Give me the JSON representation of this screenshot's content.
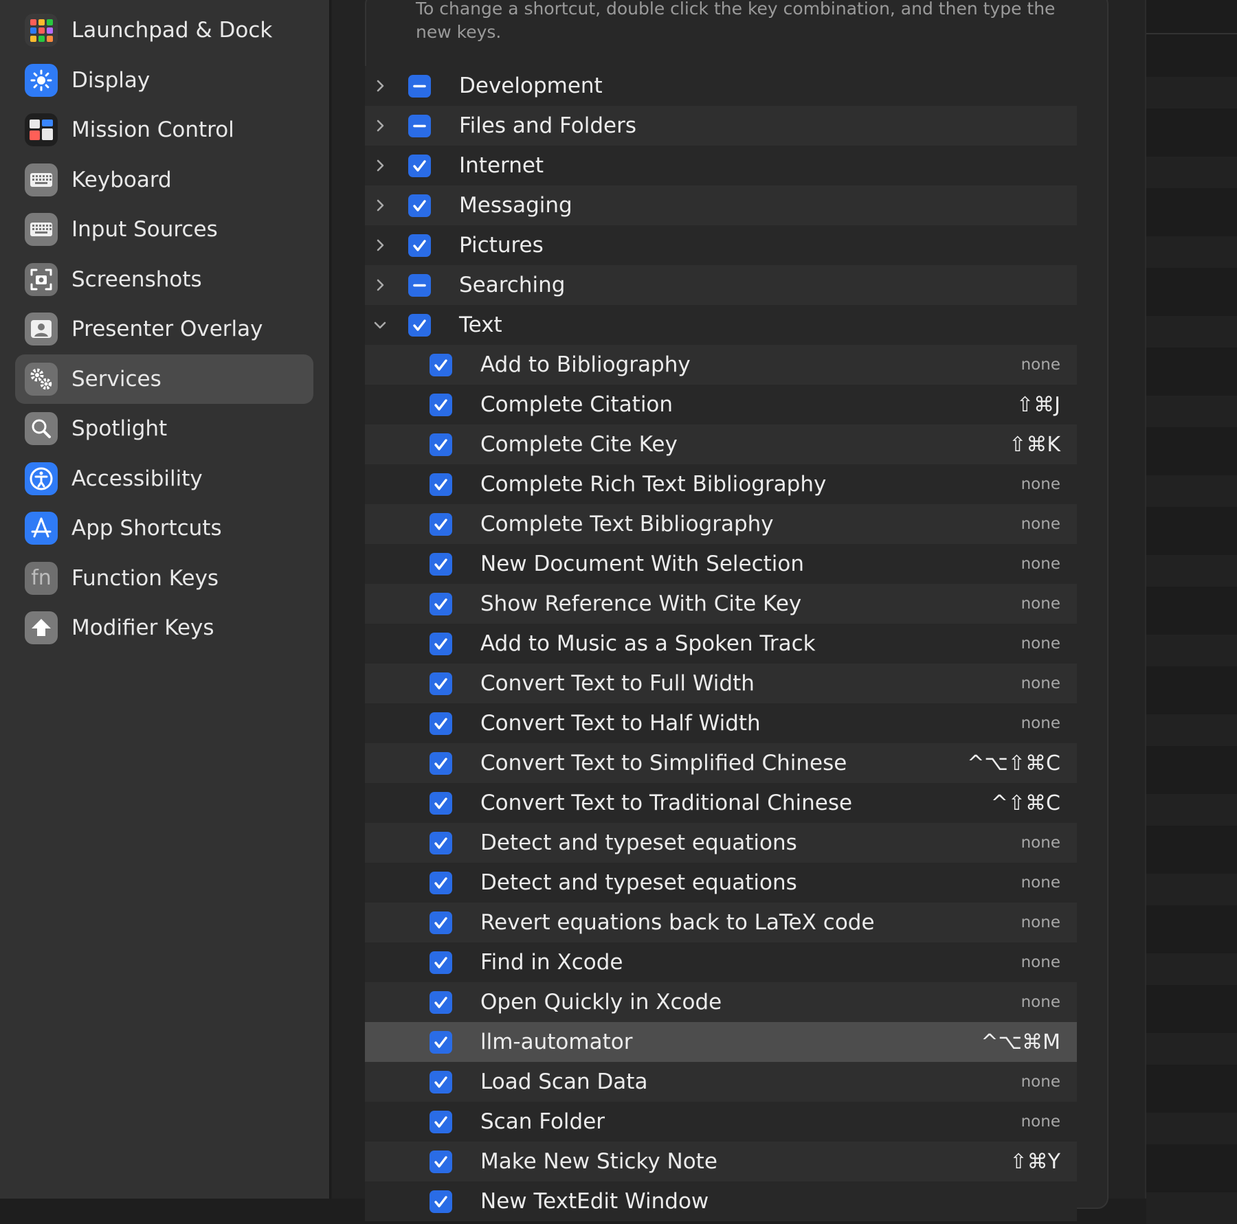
{
  "sidebar": {
    "items": [
      {
        "label": "Launchpad & Dock",
        "icon": "launchpad-dock-icon",
        "color": "#3a3a3a"
      },
      {
        "label": "Display",
        "icon": "display-brightness-icon",
        "color": "#2f7bf6"
      },
      {
        "label": "Mission Control",
        "icon": "mission-control-icon",
        "color": "#1f1f1f"
      },
      {
        "label": "Keyboard",
        "icon": "keyboard-icon",
        "color": "#7a7a7a"
      },
      {
        "label": "Input Sources",
        "icon": "input-sources-icon",
        "color": "#7a7a7a"
      },
      {
        "label": "Screenshots",
        "icon": "screenshots-icon",
        "color": "#6f6f6f"
      },
      {
        "label": "Presenter Overlay",
        "icon": "presenter-overlay-icon",
        "color": "#7a7a7a"
      },
      {
        "label": "Services",
        "icon": "services-gear-icon",
        "color": "#6f6f6f"
      },
      {
        "label": "Spotlight",
        "icon": "spotlight-icon",
        "color": "#7a7a7a"
      },
      {
        "label": "Accessibility",
        "icon": "accessibility-icon",
        "color": "#2f7bf6"
      },
      {
        "label": "App Shortcuts",
        "icon": "app-shortcuts-icon",
        "color": "#2f7bf6"
      },
      {
        "label": "Function Keys",
        "icon": "function-keys-icon",
        "color": "#6f6f6f",
        "glyph": "fn"
      },
      {
        "label": "Modifier Keys",
        "icon": "modifier-keys-icon",
        "color": "#7a7a7a"
      }
    ],
    "selected_index": 7
  },
  "main": {
    "instructions": "To change a shortcut, double click the key combination, and then type the new keys."
  },
  "rows": [
    {
      "label": "Development",
      "level": 0,
      "check": "mixed",
      "expand": "collapsed"
    },
    {
      "label": "Files and Folders",
      "level": 0,
      "check": "mixed",
      "expand": "collapsed"
    },
    {
      "label": "Internet",
      "level": 0,
      "check": "checked",
      "expand": "collapsed"
    },
    {
      "label": "Messaging",
      "level": 0,
      "check": "checked",
      "expand": "collapsed"
    },
    {
      "label": "Pictures",
      "level": 0,
      "check": "checked",
      "expand": "collapsed"
    },
    {
      "label": "Searching",
      "level": 0,
      "check": "mixed",
      "expand": "collapsed"
    },
    {
      "label": "Text",
      "level": 0,
      "check": "checked",
      "expand": "expanded"
    },
    {
      "label": "Add to Bibliography",
      "level": 1,
      "check": "checked",
      "shortcut": "none"
    },
    {
      "label": "Complete Citation",
      "level": 1,
      "check": "checked",
      "shortcut": "⇧⌘J"
    },
    {
      "label": "Complete Cite Key",
      "level": 1,
      "check": "checked",
      "shortcut": "⇧⌘K"
    },
    {
      "label": "Complete Rich Text Bibliography",
      "level": 1,
      "check": "checked",
      "shortcut": "none"
    },
    {
      "label": "Complete Text Bibliography",
      "level": 1,
      "check": "checked",
      "shortcut": "none"
    },
    {
      "label": "New Document With Selection",
      "level": 1,
      "check": "checked",
      "shortcut": "none"
    },
    {
      "label": "Show Reference With Cite Key",
      "level": 1,
      "check": "checked",
      "shortcut": "none"
    },
    {
      "label": "Add to Music as a Spoken Track",
      "level": 1,
      "check": "checked",
      "shortcut": "none"
    },
    {
      "label": "Convert Text to Full Width",
      "level": 1,
      "check": "checked",
      "shortcut": "none"
    },
    {
      "label": "Convert Text to Half Width",
      "level": 1,
      "check": "checked",
      "shortcut": "none"
    },
    {
      "label": "Convert Text to Simplified Chinese",
      "level": 1,
      "check": "checked",
      "shortcut": "^⌥⇧⌘C"
    },
    {
      "label": "Convert Text to Traditional Chinese",
      "level": 1,
      "check": "checked",
      "shortcut": "^⇧⌘C"
    },
    {
      "label": "Detect and typeset equations",
      "level": 1,
      "check": "checked",
      "shortcut": "none"
    },
    {
      "label": "Detect and typeset equations",
      "level": 1,
      "check": "checked",
      "shortcut": "none"
    },
    {
      "label": "Revert equations back to LaTeX code",
      "level": 1,
      "check": "checked",
      "shortcut": "none"
    },
    {
      "label": "Find in Xcode",
      "level": 1,
      "check": "checked",
      "shortcut": "none"
    },
    {
      "label": "Open Quickly in Xcode",
      "level": 1,
      "check": "checked",
      "shortcut": "none"
    },
    {
      "label": "llm-automator",
      "level": 1,
      "check": "checked",
      "shortcut": "^⌥⌘M",
      "selected": true
    },
    {
      "label": "Load Scan Data",
      "level": 1,
      "check": "checked",
      "shortcut": "none"
    },
    {
      "label": "Scan Folder",
      "level": 1,
      "check": "checked",
      "shortcut": "none"
    },
    {
      "label": "Make New Sticky Note",
      "level": 1,
      "check": "checked",
      "shortcut": "⇧⌘Y"
    },
    {
      "label": "New TextEdit Window",
      "level": 1,
      "check": "checked",
      "shortcut": "",
      "partial": true
    }
  ],
  "colors": {
    "accent": "#2a6ce6",
    "sidebar_bg": "#323232",
    "selected_row": "#4d4d4d"
  }
}
